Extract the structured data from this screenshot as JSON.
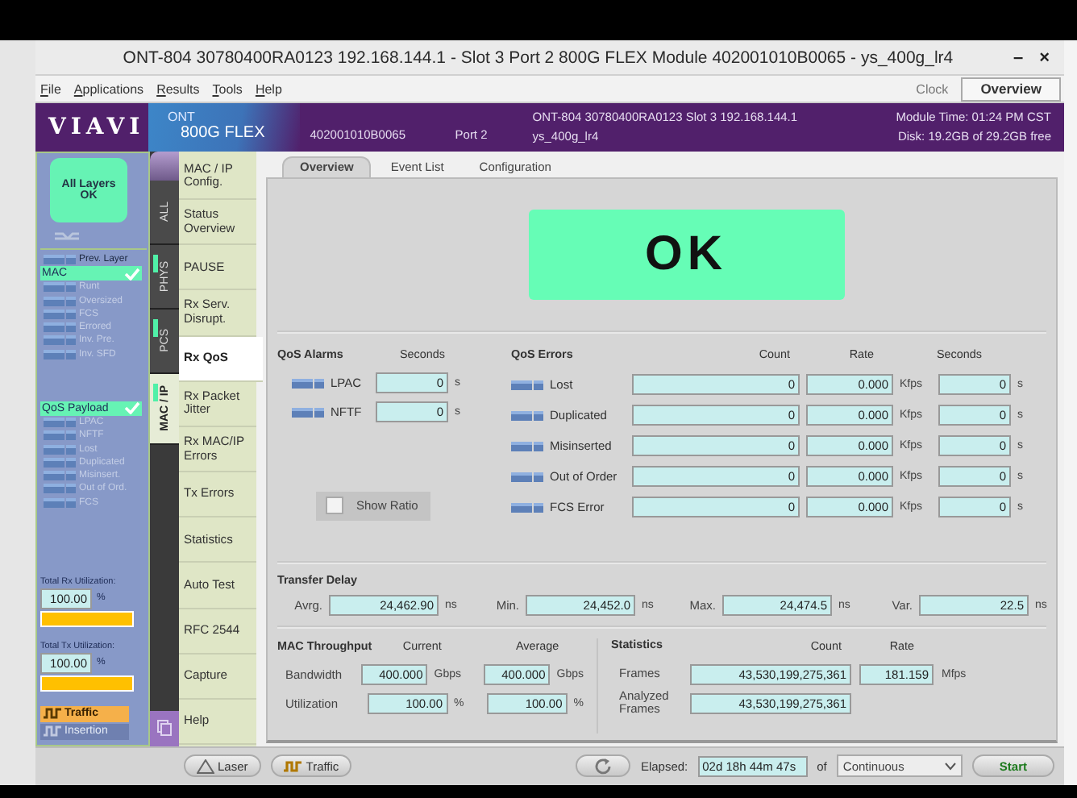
{
  "window": {
    "title": "ONT-804  30780400RA0123 192.168.144.1 - Slot 3 Port 2 800G FLEX Module 402001010B0065 - ys_400g_lr4",
    "buttons": [
      "–",
      "×"
    ]
  },
  "menu": [
    "File",
    "Applications",
    "Results",
    "Tools",
    "Help"
  ],
  "clock_label": "Clock",
  "view_button": "Overview",
  "header": {
    "logo": "VIAVI",
    "product_line": "ONT",
    "product": "800G FLEX",
    "module_id": "402001010B0065",
    "port": "Port 2",
    "info_line_1": "ONT-804 30780400RA0123 Slot 3  192.168.144.1",
    "info_line_2": "ys_400g_lr4",
    "module_time": "Module Time: 01:24 PM CST",
    "disk": "Disk: 19.2GB of 29.2GB free"
  },
  "status_panel": {
    "summary": "All Layers OK",
    "prev_layer": "Prev. Layer",
    "groups": [
      {
        "name": "MAC",
        "ok": true,
        "items": [
          "Runt",
          "Oversized",
          "FCS",
          "Errored",
          "Inv. Pre.",
          "Inv. SFD"
        ]
      },
      {
        "name": "QoS Payload",
        "ok": true,
        "items": [
          "LPAC",
          "NFTF",
          "Lost",
          "Duplicated",
          "Misinsert.",
          "Out of Ord.",
          "FCS"
        ]
      }
    ],
    "utilization": [
      {
        "label": "Total Rx Utilization:",
        "value": "100.00",
        "unit": "%",
        "level": 1
      },
      {
        "label": "Total Tx Utilization:",
        "value": "100.00",
        "unit": "%",
        "level": 1
      }
    ],
    "actions": [
      {
        "label": "Traffic",
        "disabled": false
      },
      {
        "label": "Insertion",
        "disabled": true
      }
    ]
  },
  "layer_tabs": [
    {
      "label": "ALL",
      "indicator": false,
      "selected": false
    },
    {
      "label": "PHYS",
      "indicator": true,
      "selected": false
    },
    {
      "label": "PCS",
      "indicator": true,
      "selected": false
    },
    {
      "label": "MAC / IP",
      "indicator": true,
      "selected": true
    }
  ],
  "nav": [
    {
      "label": "MAC / IP Config.",
      "selected": false
    },
    {
      "label": "Status Overview",
      "selected": false
    },
    {
      "label": "PAUSE",
      "selected": false
    },
    {
      "label": "Rx Serv. Disrupt.",
      "selected": false
    },
    {
      "label": "Rx QoS",
      "selected": true
    },
    {
      "label": "Rx Packet Jitter",
      "selected": false
    },
    {
      "label": "Rx MAC/IP Errors",
      "selected": false
    },
    {
      "label": "Tx Errors",
      "selected": false
    },
    {
      "label": "Statistics",
      "selected": false
    },
    {
      "label": "Auto Test",
      "selected": false
    },
    {
      "label": "RFC 2544",
      "selected": false
    },
    {
      "label": "Capture",
      "selected": false
    },
    {
      "label": "Help",
      "selected": false
    }
  ],
  "content_tabs": [
    {
      "label": "Overview",
      "selected": true
    },
    {
      "label": "Event List",
      "selected": false
    },
    {
      "label": "Configuration",
      "selected": false
    }
  ],
  "status_text": "OK",
  "qos_alarms": {
    "title": "QoS Alarms",
    "seconds_header": "Seconds",
    "rows": [
      {
        "label": "LPAC",
        "seconds": "0",
        "unit": "s"
      },
      {
        "label": "NFTF",
        "seconds": "0",
        "unit": "s"
      }
    ]
  },
  "show_ratio": {
    "label": "Show Ratio",
    "checked": false
  },
  "qos_errors": {
    "title": "QoS Errors",
    "columns": [
      "Count",
      "Rate",
      "Seconds"
    ],
    "rows": [
      {
        "label": "Lost",
        "count": "0",
        "rate": "0.000",
        "rate_unit": "Kfps",
        "seconds": "0",
        "seconds_unit": "s"
      },
      {
        "label": "Duplicated",
        "count": "0",
        "rate": "0.000",
        "rate_unit": "Kfps",
        "seconds": "0",
        "seconds_unit": "s"
      },
      {
        "label": "Misinserted",
        "count": "0",
        "rate": "0.000",
        "rate_unit": "Kfps",
        "seconds": "0",
        "seconds_unit": "s"
      },
      {
        "label": "Out of Order",
        "count": "0",
        "rate": "0.000",
        "rate_unit": "Kfps",
        "seconds": "0",
        "seconds_unit": "s"
      },
      {
        "label": "FCS Error",
        "count": "0",
        "rate": "0.000",
        "rate_unit": "Kfps",
        "seconds": "0",
        "seconds_unit": "s"
      }
    ]
  },
  "transfer_delay": {
    "title": "Transfer Delay",
    "fields": [
      {
        "label": "Avrg.",
        "value": "24,462.90",
        "unit": "ns"
      },
      {
        "label": "Min.",
        "value": "24,452.0",
        "unit": "ns"
      },
      {
        "label": "Max.",
        "value": "24,474.5",
        "unit": "ns"
      },
      {
        "label": "Var.",
        "value": "22.5",
        "unit": "ns"
      }
    ]
  },
  "mac_throughput": {
    "title": "MAC Throughput",
    "columns": [
      "Current",
      "Average"
    ],
    "rows": [
      {
        "label": "Bandwidth",
        "current": "400.000",
        "current_unit": "Gbps",
        "average": "400.000",
        "average_unit": "Gbps"
      },
      {
        "label": "Utilization",
        "current": "100.00",
        "current_unit": "%",
        "average": "100.00",
        "average_unit": "%"
      }
    ]
  },
  "statistics": {
    "title": "Statistics",
    "columns": [
      "Count",
      "Rate"
    ],
    "rows": [
      {
        "label": "Frames",
        "count": "43,530,199,275,361",
        "rate": "181.159",
        "rate_unit": "Mfps"
      },
      {
        "label": "Analyzed Frames",
        "count": "43,530,199,275,361"
      }
    ]
  },
  "bottom_bar": {
    "laser": "Laser",
    "traffic": "Traffic",
    "elapsed_label": "Elapsed:",
    "elapsed": "02d 18h 44m 47s",
    "of": "of",
    "duration": "Continuous",
    "start": "Start"
  }
}
